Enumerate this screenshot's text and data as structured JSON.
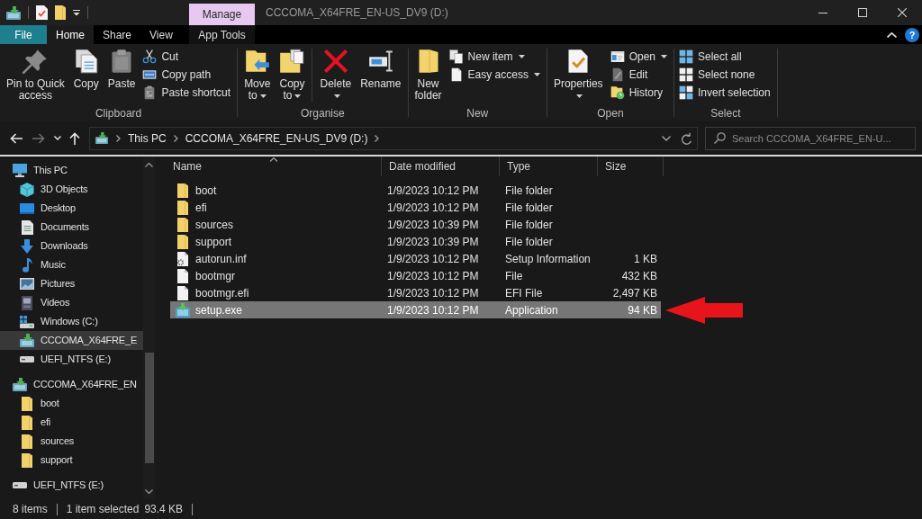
{
  "window": {
    "title": "CCCOMA_X64FRE_EN-US_DV9 (D:)",
    "context_tab": "Manage"
  },
  "ribbon": {
    "file_tab": "File",
    "tabs": [
      {
        "label": "Home",
        "selected": true,
        "contextual": false
      },
      {
        "label": "Share",
        "selected": false,
        "contextual": false
      },
      {
        "label": "View",
        "selected": false,
        "contextual": false
      },
      {
        "label": "App Tools",
        "selected": false,
        "contextual": true
      }
    ],
    "help": "?",
    "groups": [
      {
        "label": "Clipboard",
        "items": [
          {
            "kind": "pin",
            "label": "Pin to Quick access",
            "dropdown": false
          },
          {
            "kind": "copy",
            "label": "Copy",
            "dropdown": false
          },
          {
            "kind": "paste",
            "label": "Paste",
            "dropdown": false
          },
          {
            "kind": "stack",
            "items": [
              {
                "kind": "cut",
                "label": "Cut",
                "dropdown": false
              },
              {
                "kind": "copypath",
                "label": "Copy path",
                "dropdown": false
              },
              {
                "kind": "pasteshortcut",
                "label": "Paste shortcut",
                "dropdown": false
              }
            ]
          }
        ]
      },
      {
        "label": "Organise",
        "items": [
          {
            "kind": "moveto",
            "label": "Move to",
            "dropdown": true
          },
          {
            "kind": "copyto",
            "label": "Copy to",
            "dropdown": true
          },
          {
            "kind": "separator"
          },
          {
            "kind": "delete",
            "label": "Delete",
            "dropdown": true
          },
          {
            "kind": "rename",
            "label": "Rename",
            "dropdown": false
          }
        ]
      },
      {
        "label": "New",
        "items": [
          {
            "kind": "newfolder",
            "label": "New folder",
            "dropdown": false
          },
          {
            "kind": "stack",
            "items": [
              {
                "kind": "newitem",
                "label": "New item",
                "dropdown": true
              },
              {
                "kind": "easyaccess",
                "label": "Easy access",
                "dropdown": true
              }
            ]
          }
        ]
      },
      {
        "label": "Open",
        "items": [
          {
            "kind": "properties",
            "label": "Properties",
            "dropdown": true
          },
          {
            "kind": "stack",
            "items": [
              {
                "kind": "open",
                "label": "Open",
                "dropdown": true
              },
              {
                "kind": "edit",
                "label": "Edit",
                "dropdown": false
              },
              {
                "kind": "history",
                "label": "History",
                "dropdown": false
              }
            ]
          }
        ]
      },
      {
        "label": "Select",
        "items": [
          {
            "kind": "stack",
            "items": [
              {
                "kind": "selectall",
                "label": "Select all",
                "dropdown": false
              },
              {
                "kind": "selectnone",
                "label": "Select none",
                "dropdown": false
              },
              {
                "kind": "invert",
                "label": "Invert selection",
                "dropdown": false
              }
            ]
          }
        ]
      }
    ]
  },
  "navigation": {
    "buttons": [
      {
        "kind": "back",
        "disabled": false
      },
      {
        "kind": "forward",
        "disabled": true
      },
      {
        "kind": "recent",
        "disabled": false
      },
      {
        "kind": "up",
        "disabled": false
      }
    ],
    "path": [
      "This PC",
      "CCCOMA_X64FRE_EN-US_DV9 (D:)"
    ]
  },
  "search": {
    "placeholder": "Search CCCOMA_X64FRE_EN-U..."
  },
  "sidebar": {
    "items": [
      {
        "label": "This PC",
        "kind": "pc",
        "selected": false,
        "children": [
          {
            "label": "3D Objects",
            "kind": "objects3d",
            "selected": false
          },
          {
            "label": "Desktop",
            "kind": "desktop",
            "selected": false
          },
          {
            "label": "Documents",
            "kind": "documents",
            "selected": false
          },
          {
            "label": "Downloads",
            "kind": "downloads",
            "selected": false
          },
          {
            "label": "Music",
            "kind": "music",
            "selected": false
          },
          {
            "label": "Pictures",
            "kind": "pictures",
            "selected": false
          },
          {
            "label": "Videos",
            "kind": "videos",
            "selected": false
          },
          {
            "label": "Windows (C:)",
            "kind": "systemdrive",
            "selected": false
          },
          {
            "label": "CCCOMA_X64FRE_E",
            "kind": "mediadrive",
            "selected": true
          },
          {
            "label": "UEFI_NTFS (E:)",
            "kind": "drive",
            "selected": false
          }
        ]
      },
      {
        "label": "CCCOMA_X64FRE_EN",
        "kind": "mediadrive",
        "selected": false,
        "children": [
          {
            "label": "boot",
            "kind": "folder",
            "selected": false
          },
          {
            "label": "efi",
            "kind": "folder",
            "selected": false
          },
          {
            "label": "sources",
            "kind": "folder",
            "selected": false
          },
          {
            "label": "support",
            "kind": "folder",
            "selected": false
          }
        ]
      },
      {
        "label": "UEFI_NTFS (E:)",
        "kind": "drive",
        "selected": false
      }
    ]
  },
  "file_list": {
    "columns": [
      {
        "label": "Name",
        "sorted": true
      },
      {
        "label": "Date modified",
        "sorted": false
      },
      {
        "label": "Type",
        "sorted": false
      },
      {
        "label": "Size",
        "sorted": false
      }
    ],
    "rows": [
      {
        "kind": "folder",
        "name": "boot",
        "date_modified": "1/9/2023 10:12 PM",
        "type": "File folder",
        "selected": false,
        "arrow": false
      },
      {
        "kind": "folder",
        "name": "efi",
        "date_modified": "1/9/2023 10:12 PM",
        "type": "File folder",
        "selected": false,
        "arrow": false
      },
      {
        "kind": "folder",
        "name": "sources",
        "date_modified": "1/9/2023 10:39 PM",
        "type": "File folder",
        "selected": false,
        "arrow": false
      },
      {
        "kind": "folder",
        "name": "support",
        "date_modified": "1/9/2023 10:39 PM",
        "type": "File folder",
        "selected": false,
        "arrow": false
      },
      {
        "kind": "settings",
        "name": "autorun.inf",
        "date_modified": "1/9/2023 10:12 PM",
        "type": "Setup Information",
        "size": "1 KB",
        "selected": false,
        "arrow": false
      },
      {
        "kind": "file",
        "name": "bootmgr",
        "date_modified": "1/9/2023 10:12 PM",
        "type": "File",
        "size": "432 KB",
        "selected": false,
        "arrow": false
      },
      {
        "kind": "file",
        "name": "bootmgr.efi",
        "date_modified": "1/9/2023 10:12 PM",
        "type": "EFI File",
        "size": "2,497 KB",
        "selected": false,
        "arrow": false
      },
      {
        "kind": "app",
        "name": "setup.exe",
        "date_modified": "1/9/2023 10:12 PM",
        "type": "Application",
        "size": "94 KB",
        "selected": true,
        "arrow": true
      }
    ]
  },
  "status_bar": {
    "item_count": "8 items",
    "selection": "1 item selected",
    "selection_size": "93.4 KB"
  }
}
